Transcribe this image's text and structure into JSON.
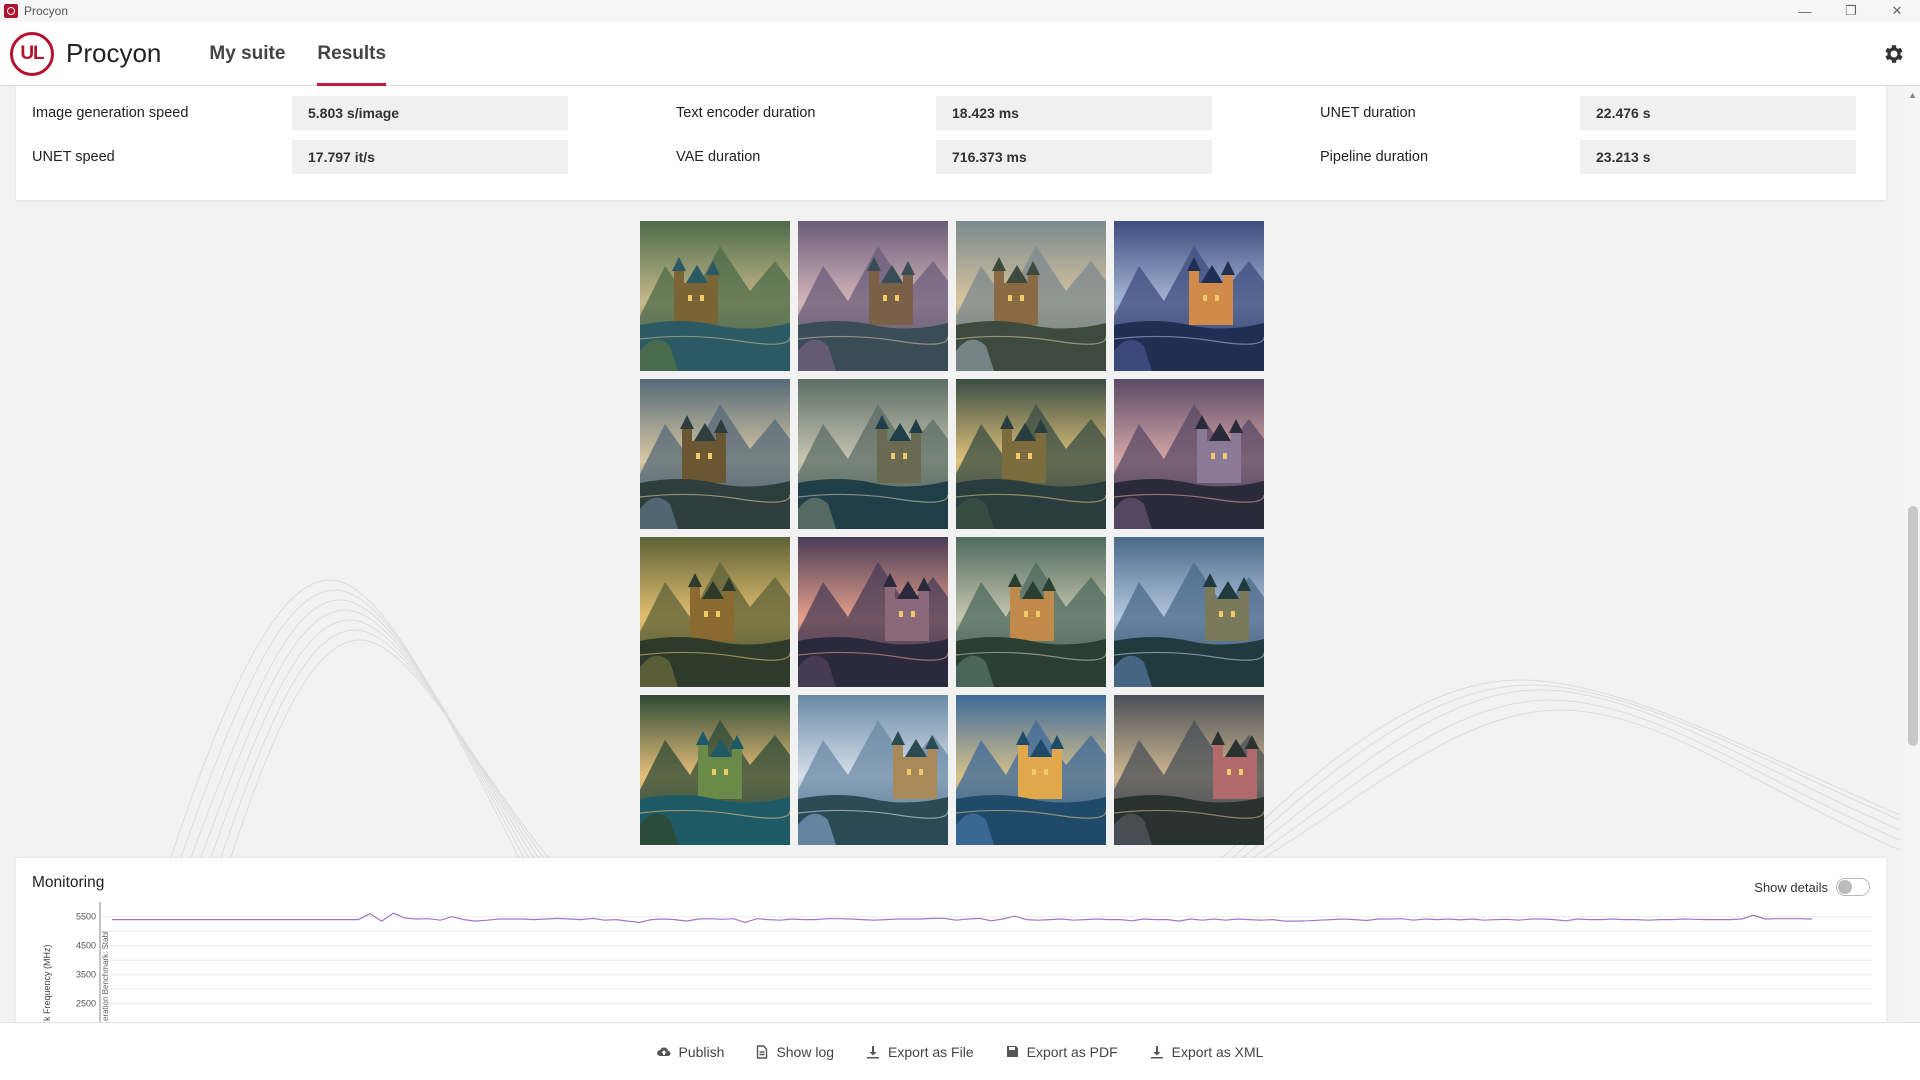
{
  "window": {
    "title": "Procyon"
  },
  "header": {
    "brand": "Procyon",
    "logo_text": "UL",
    "tabs": [
      {
        "label": "My suite",
        "active": false
      },
      {
        "label": "Results",
        "active": true
      }
    ],
    "settings_icon": "gear-icon"
  },
  "stats": {
    "items": [
      {
        "label": "Image generation speed",
        "value": "5.803 s/image"
      },
      {
        "label": "Text encoder duration",
        "value": "18.423 ms"
      },
      {
        "label": "UNET duration",
        "value": "22.476 s"
      },
      {
        "label": "UNET speed",
        "value": "17.797 it/s"
      },
      {
        "label": "VAE duration",
        "value": "716.373 ms"
      },
      {
        "label": "Pipeline duration",
        "value": "23.213 s"
      }
    ]
  },
  "images": {
    "count": 16,
    "palettes": [
      [
        "#4d6b4a",
        "#c7b98a",
        "#2b5a64",
        "#7a6335"
      ],
      [
        "#6a5c7a",
        "#d5b7b9",
        "#3a4c55",
        "#7a6046"
      ],
      [
        "#7b8a8e",
        "#d9c5a0",
        "#3e4a3d",
        "#8a6a42"
      ],
      [
        "#3d4d7e",
        "#a9b7d8",
        "#1f2e52",
        "#d08a4a"
      ],
      [
        "#556a78",
        "#d8c8a4",
        "#2d3e3c",
        "#6a5632"
      ],
      [
        "#5c6e66",
        "#c9c6b2",
        "#1f3e48",
        "#6a6a52"
      ],
      [
        "#3a4d44",
        "#e0c27a",
        "#2a3d3e",
        "#7c6b3c"
      ],
      [
        "#5a4a66",
        "#d9a9a8",
        "#2a2a3a",
        "#8a7a98"
      ],
      [
        "#5e6238",
        "#e5c070",
        "#2e3a2a",
        "#8a6a30"
      ],
      [
        "#4a3c56",
        "#e6a08c",
        "#2a2a3c",
        "#8a6a7a"
      ],
      [
        "#4e6a5e",
        "#c8c8b0",
        "#2a3e32",
        "#c08a4a"
      ],
      [
        "#4a6a8a",
        "#b6c8e0",
        "#213a3e",
        "#7a7a5a"
      ],
      [
        "#2e4a36",
        "#e8c07a",
        "#1e5a66",
        "#6a8a4a"
      ],
      [
        "#6a8aa6",
        "#d8e0ea",
        "#2a4a54",
        "#a88a5a"
      ],
      [
        "#3e6a9a",
        "#d8c28a",
        "#1f4a6a",
        "#e0a84a"
      ],
      [
        "#4a5058",
        "#d0b890",
        "#2a3230",
        "#b06a6a"
      ]
    ]
  },
  "monitoring": {
    "title": "Monitoring",
    "show_details_label": "Show details",
    "show_details_on": false,
    "y_axis_label": "Clock Frequency (MHz)",
    "y_axis_label_visible": "k Frequency (MHz)",
    "marker_label_visible": "eration Benchmark: Stabl",
    "y_ticks": [
      "5500",
      "4500",
      "3500",
      "2500"
    ],
    "series_color": "#9b7bc7"
  },
  "chart_data": {
    "type": "line",
    "ylabel": "Clock Frequency (MHz)",
    "yticks": [
      5500,
      4500,
      3500,
      2500
    ],
    "series": [
      {
        "values": [
          5400,
          5400,
          5400,
          5400,
          5400,
          5400,
          5400,
          5400,
          5400,
          5400,
          5400,
          5400,
          5400,
          5400,
          5400,
          5400,
          5400,
          5400,
          5400,
          5400,
          5400,
          5400,
          5600,
          5350,
          5620,
          5450,
          5420,
          5430,
          5380,
          5500,
          5400,
          5350,
          5380,
          5420,
          5420,
          5420,
          5400,
          5420,
          5440,
          5420,
          5400,
          5440,
          5380,
          5400,
          5350,
          5300,
          5400,
          5420,
          5400,
          5350,
          5420,
          5430,
          5410,
          5430,
          5300,
          5430,
          5400,
          5380,
          5420,
          5400,
          5400,
          5430,
          5430,
          5420,
          5400,
          5380,
          5400,
          5420,
          5420,
          5420,
          5440,
          5440,
          5380,
          5420,
          5440,
          5360,
          5420,
          5520,
          5400,
          5380,
          5400,
          5420,
          5380,
          5400,
          5420,
          5400,
          5400,
          5360,
          5420,
          5400,
          5400,
          5350,
          5420,
          5380,
          5420,
          5380,
          5420,
          5400,
          5380,
          5400,
          5350,
          5350,
          5360,
          5380,
          5400,
          5420,
          5400,
          5370,
          5420,
          5420,
          5430,
          5380,
          5420,
          5400,
          5420,
          5390,
          5420,
          5380,
          5400,
          5410,
          5380,
          5420,
          5420,
          5400,
          5360,
          5420,
          5400,
          5400,
          5420,
          5400,
          5400,
          5380,
          5400,
          5400,
          5420,
          5410,
          5400,
          5400,
          5400,
          5420,
          5550,
          5420,
          5430,
          5430,
          5430,
          5420
        ]
      }
    ]
  },
  "actions": [
    {
      "label": "Publish",
      "icon": "cloud-upload-icon"
    },
    {
      "label": "Show log",
      "icon": "document-icon"
    },
    {
      "label": "Export as File",
      "icon": "download-icon"
    },
    {
      "label": "Export as PDF",
      "icon": "save-icon"
    },
    {
      "label": "Export as XML",
      "icon": "download-icon"
    }
  ]
}
